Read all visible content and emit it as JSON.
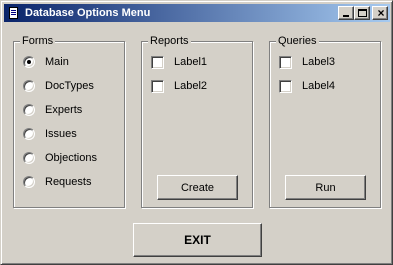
{
  "window": {
    "title": "Database Options Menu",
    "icon": "form-app-icon"
  },
  "title_buttons": {
    "minimize": "minimize-icon",
    "maximize": "maximize-icon",
    "close": "×"
  },
  "forms": {
    "label": "Forms",
    "options": [
      {
        "label": "Main",
        "checked": true
      },
      {
        "label": "DocTypes",
        "checked": false
      },
      {
        "label": "Experts",
        "checked": false
      },
      {
        "label": "Issues",
        "checked": false
      },
      {
        "label": "Objections",
        "checked": false
      },
      {
        "label": "Requests",
        "checked": false
      }
    ]
  },
  "reports": {
    "label": "Reports",
    "items": [
      {
        "label": "Label1",
        "checked": false
      },
      {
        "label": "Label2",
        "checked": false
      }
    ],
    "button_label": "Create"
  },
  "queries": {
    "label": "Queries",
    "items": [
      {
        "label": "Label3",
        "checked": false
      },
      {
        "label": "Label4",
        "checked": false
      }
    ],
    "button_label": "Run"
  },
  "exit_label": "EXIT"
}
